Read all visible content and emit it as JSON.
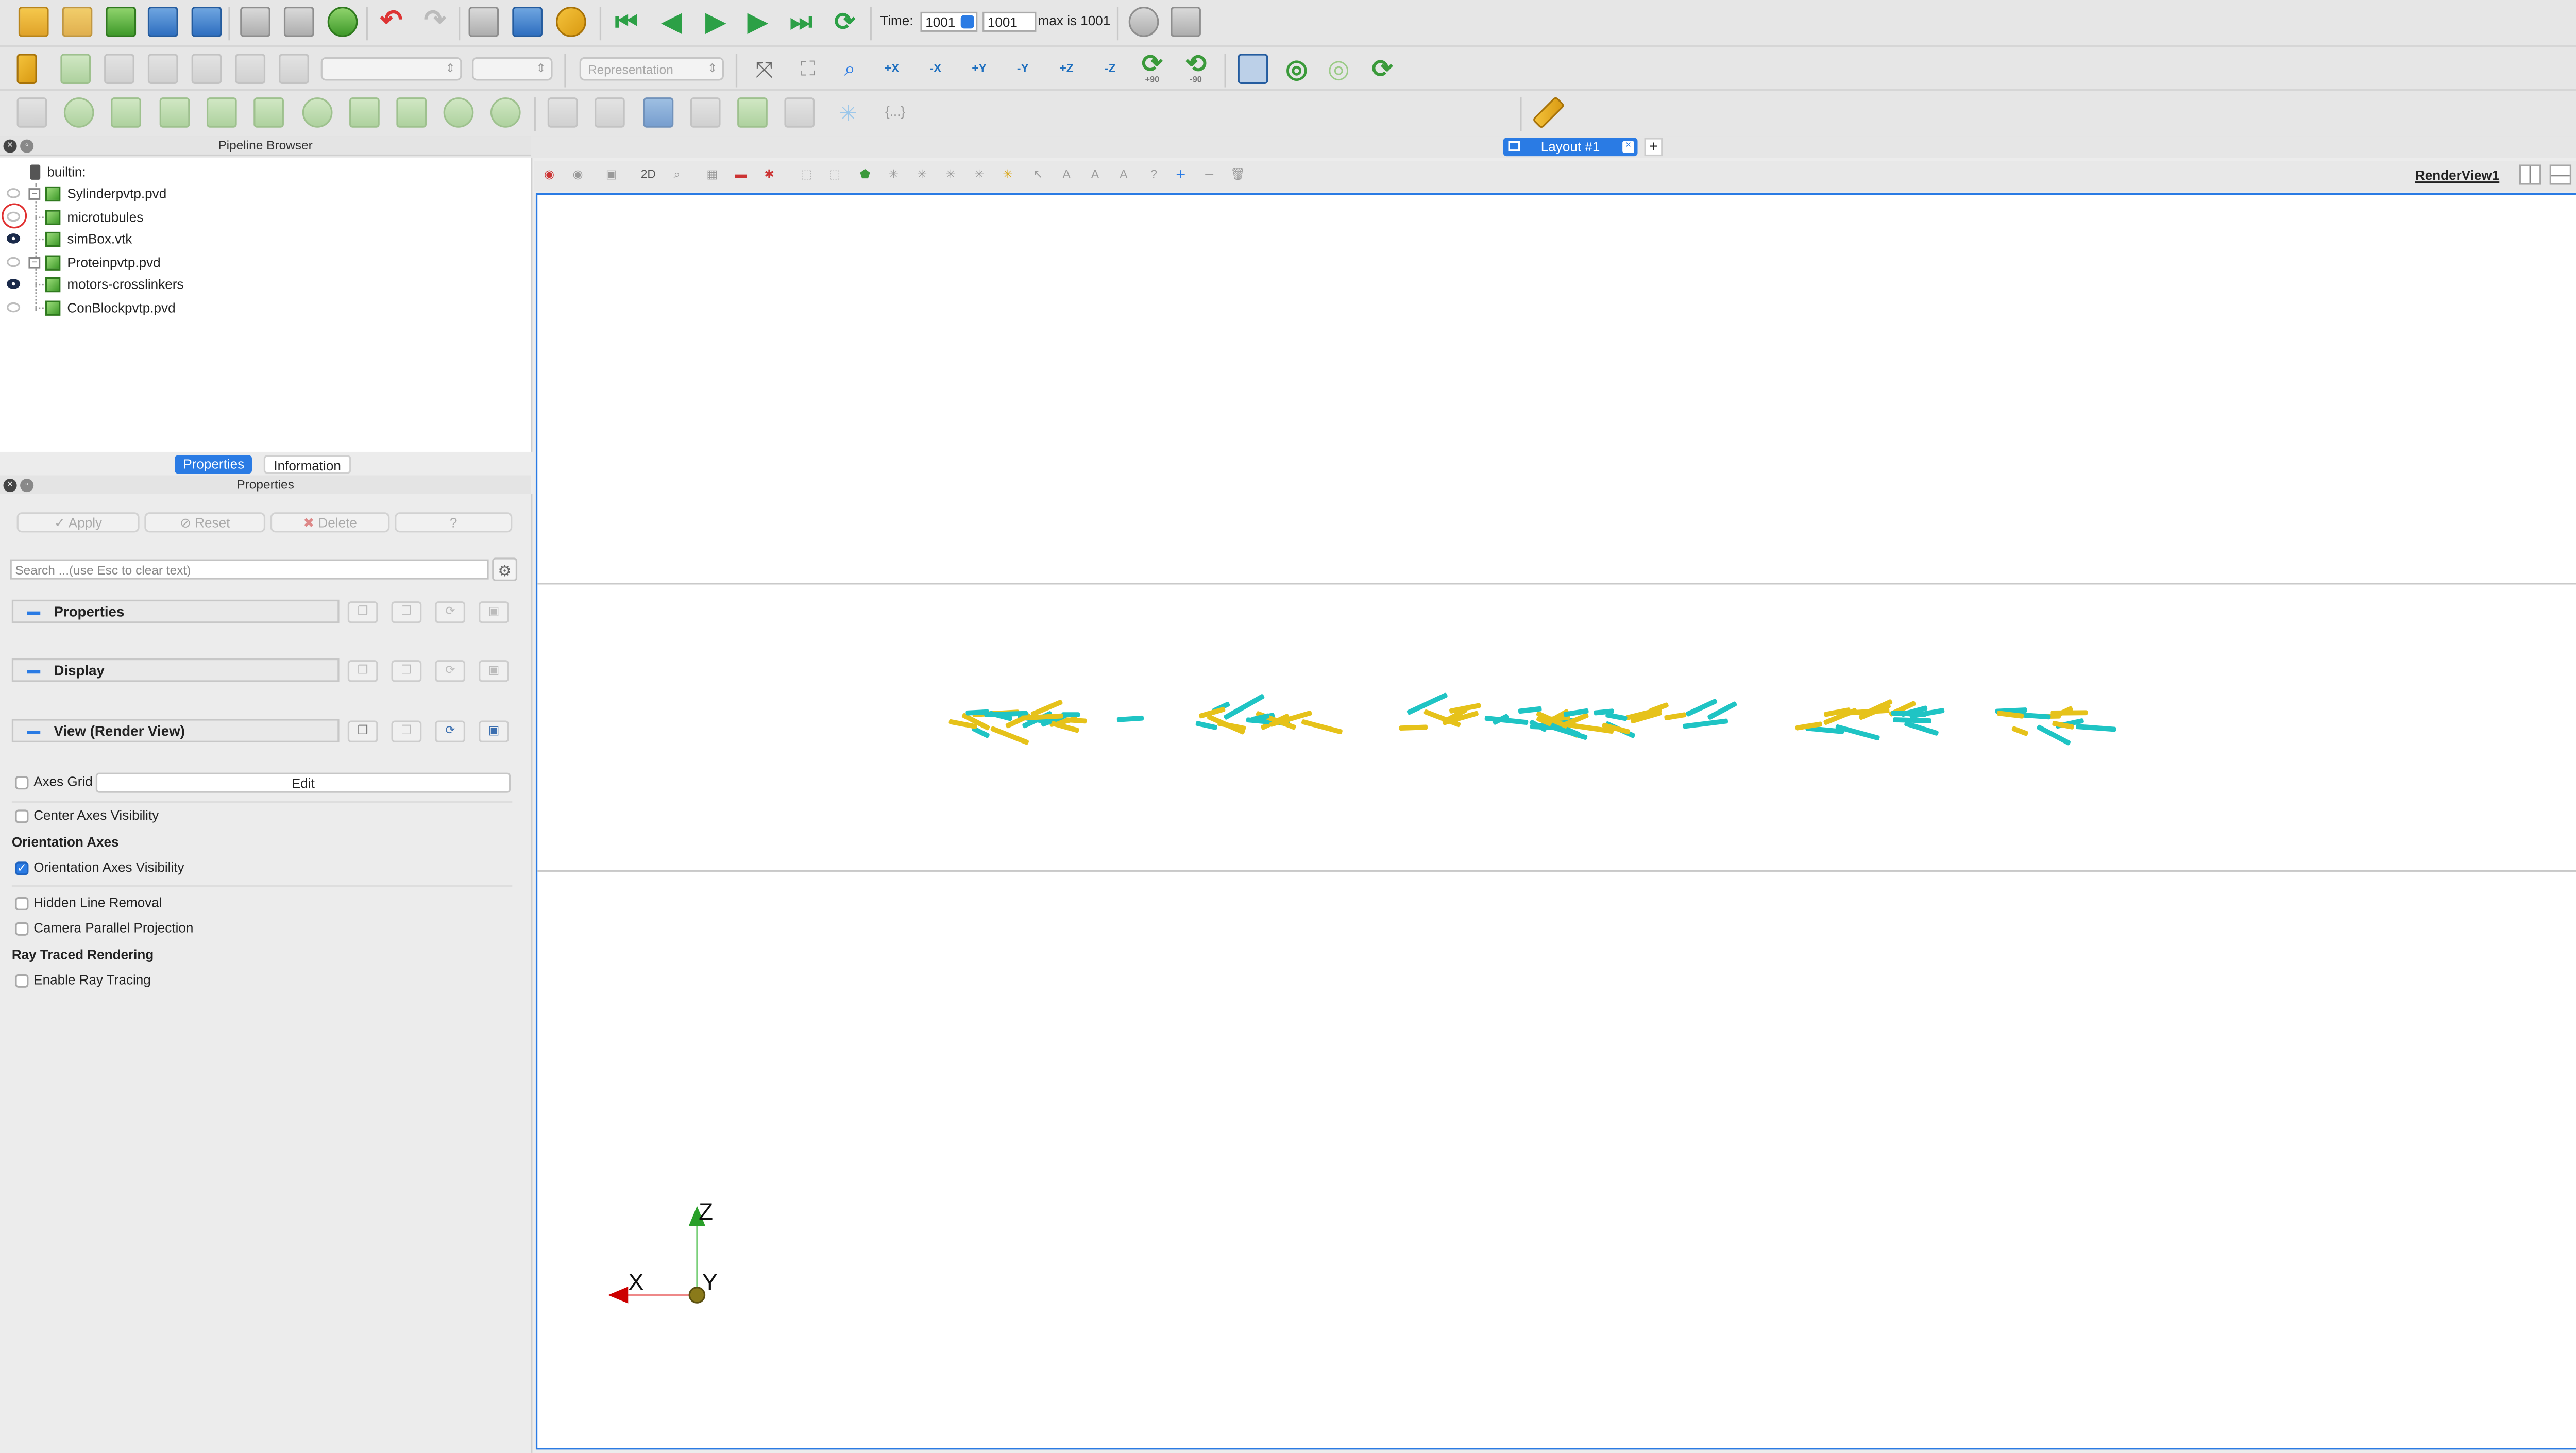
{
  "toolbar": {
    "time_label": "Time:",
    "time_value": "1001",
    "time_index": "1001",
    "time_max": "max is 1001",
    "representation_placeholder": "Representation",
    "view_axes_buttons": [
      "+X",
      "-X",
      "+Y",
      "-Y",
      "+Z",
      "-Z"
    ],
    "rotate_buttons": [
      "+90",
      "-90"
    ],
    "braces_label": "{...}"
  },
  "pipeline_browser": {
    "title": "Pipeline Browser",
    "root": "builtin:",
    "items": [
      {
        "label": "Sylinderpvtp.pvd",
        "visible": false,
        "expandable": true
      },
      {
        "label": "microtubules",
        "visible": false,
        "expandable": false
      },
      {
        "label": "simBox.vtk",
        "visible": true,
        "expandable": false
      },
      {
        "label": "Proteinpvtp.pvd",
        "visible": false,
        "expandable": true
      },
      {
        "label": "motors-crosslinkers",
        "visible": true,
        "expandable": false
      },
      {
        "label": "ConBlockpvtp.pvd",
        "visible": false,
        "expandable": false
      }
    ]
  },
  "tabs": {
    "properties": "Properties",
    "information": "Information"
  },
  "properties_panel": {
    "title": "Properties",
    "apply": "Apply",
    "reset": "Reset",
    "delete": "Delete",
    "help": "?",
    "search_placeholder": "Search ...(use Esc to clear text)",
    "sections": [
      "Properties",
      "Display",
      "View (Render View)"
    ],
    "axes_grid": "Axes Grid",
    "edit": "Edit",
    "center_axes_visibility": "Center Axes Visibility",
    "orientation_axes_header": "Orientation Axes",
    "orientation_axes_visibility": "Orientation Axes Visibility",
    "hidden_line_removal": "Hidden Line Removal",
    "camera_parallel_projection": "Camera Parallel Projection",
    "ray_traced_header": "Ray Traced Rendering",
    "enable_ray_tracing": "Enable Ray Tracing"
  },
  "layout": {
    "tab_label": "Layout #1",
    "add": "+"
  },
  "view": {
    "name": "RenderView1",
    "mode_2d": "2D",
    "axes": {
      "x": "X",
      "y": "Y",
      "z": "Z"
    }
  },
  "colors": {
    "accent": "#2a7be4",
    "fiber_cyan": "#1fc4c4",
    "fiber_yellow": "#e6c21a"
  }
}
